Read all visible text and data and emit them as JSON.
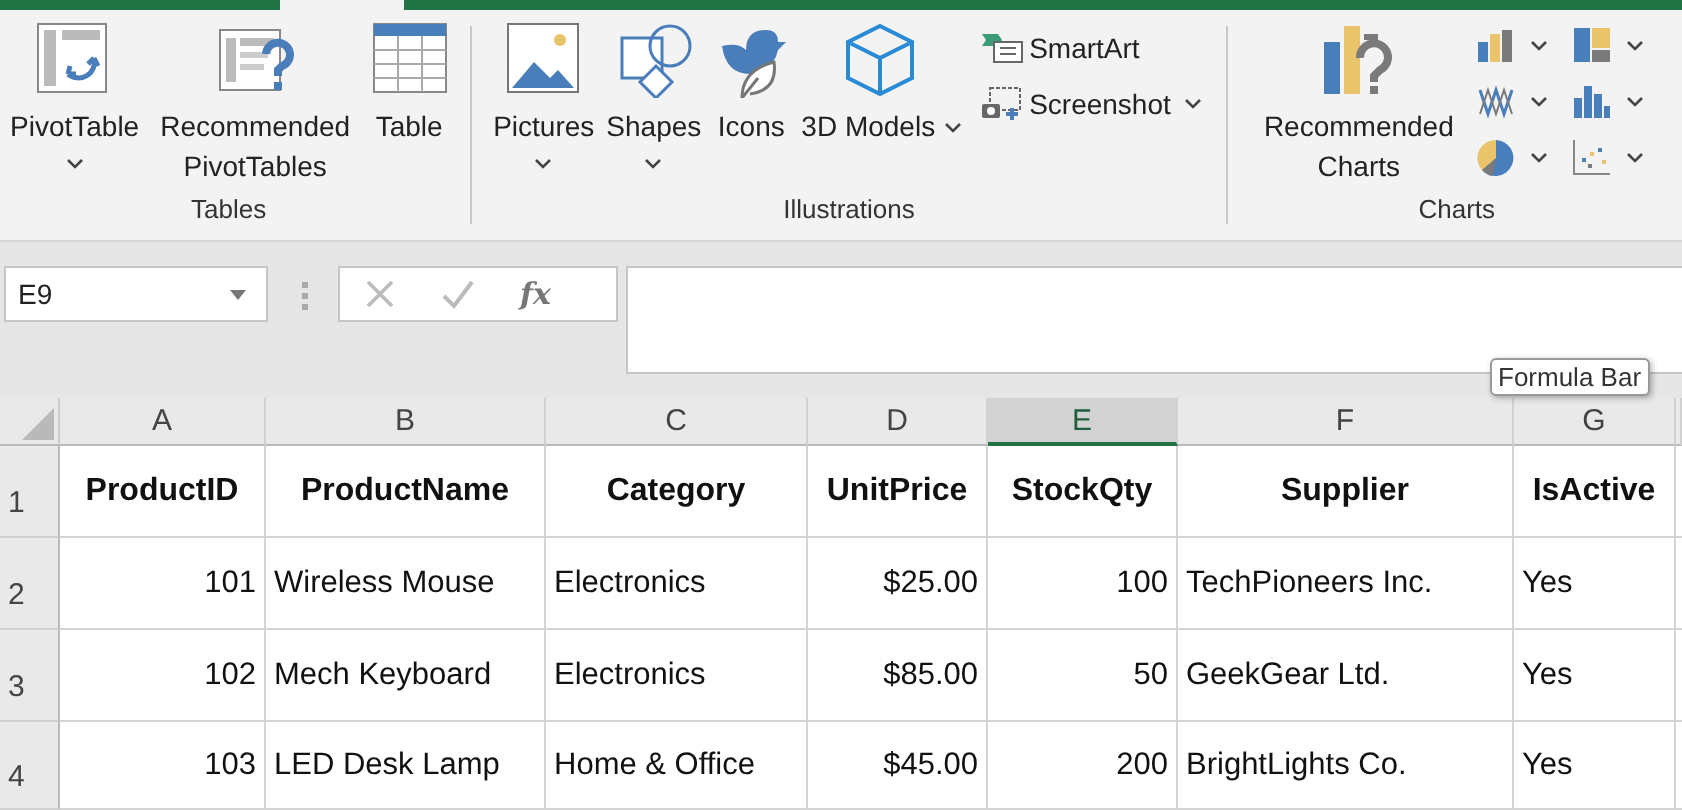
{
  "ribbon": {
    "groups": [
      {
        "label": "Tables",
        "buttons": [
          {
            "label": "PivotTable",
            "dropdown": true,
            "caret_inline": false
          },
          {
            "label": "Recommended PivotTables",
            "dropdown": false
          },
          {
            "label": "Table",
            "dropdown": false
          }
        ]
      },
      {
        "label": "Illustrations",
        "buttons": [
          {
            "label": "Pictures",
            "dropdown": true,
            "caret_inline": false
          },
          {
            "label": "Shapes",
            "dropdown": true,
            "caret_inline": false
          },
          {
            "label": "Icons",
            "dropdown": false
          },
          {
            "label": "3D Models",
            "dropdown": true,
            "caret_inline": true
          }
        ],
        "small_buttons": [
          {
            "label": "SmartArt",
            "dropdown": false
          },
          {
            "label": "Screenshot",
            "dropdown": true
          }
        ]
      },
      {
        "label": "Charts",
        "buttons": [
          {
            "label": "Recommended Charts"
          }
        ],
        "gallery": [
          {
            "dropdown": true
          },
          {
            "dropdown": true
          },
          {
            "dropdown": true
          },
          {
            "dropdown": true
          },
          {
            "dropdown": true
          },
          {
            "dropdown": true
          }
        ]
      }
    ]
  },
  "formula_bar": {
    "name_box": "E9",
    "function_button": "fx",
    "tooltip": "Formula Bar"
  },
  "sheet": {
    "columns": [
      {
        "label": "A",
        "selected": false,
        "right_aligned": true
      },
      {
        "label": "B",
        "selected": false,
        "right_aligned": false
      },
      {
        "label": "C",
        "selected": false,
        "right_aligned": false
      },
      {
        "label": "D",
        "selected": false,
        "right_aligned": true
      },
      {
        "label": "E",
        "selected": true,
        "right_aligned": true
      },
      {
        "label": "F",
        "selected": false,
        "right_aligned": false
      },
      {
        "label": "G",
        "selected": false,
        "right_aligned": false
      }
    ],
    "rows": [
      {
        "number": "1",
        "kind": "header",
        "cells": [
          "ProductID",
          "ProductName",
          "Category",
          "UnitPrice",
          "StockQty",
          "Supplier",
          "IsActive"
        ]
      },
      {
        "number": "2",
        "kind": "data",
        "cells": [
          "101",
          "Wireless Mouse",
          "Electronics",
          "$25.00",
          "100",
          "TechPioneers Inc.",
          "Yes"
        ]
      },
      {
        "number": "3",
        "kind": "data",
        "cells": [
          "102",
          "Mech Keyboard",
          "Electronics",
          "$85.00",
          "50",
          "GeekGear Ltd.",
          "Yes"
        ]
      },
      {
        "number": "4",
        "kind": "data",
        "cells": [
          "103",
          "LED Desk Lamp",
          "Home & Office",
          "$45.00",
          "200",
          "BrightLights Co.",
          "Yes"
        ]
      }
    ]
  }
}
